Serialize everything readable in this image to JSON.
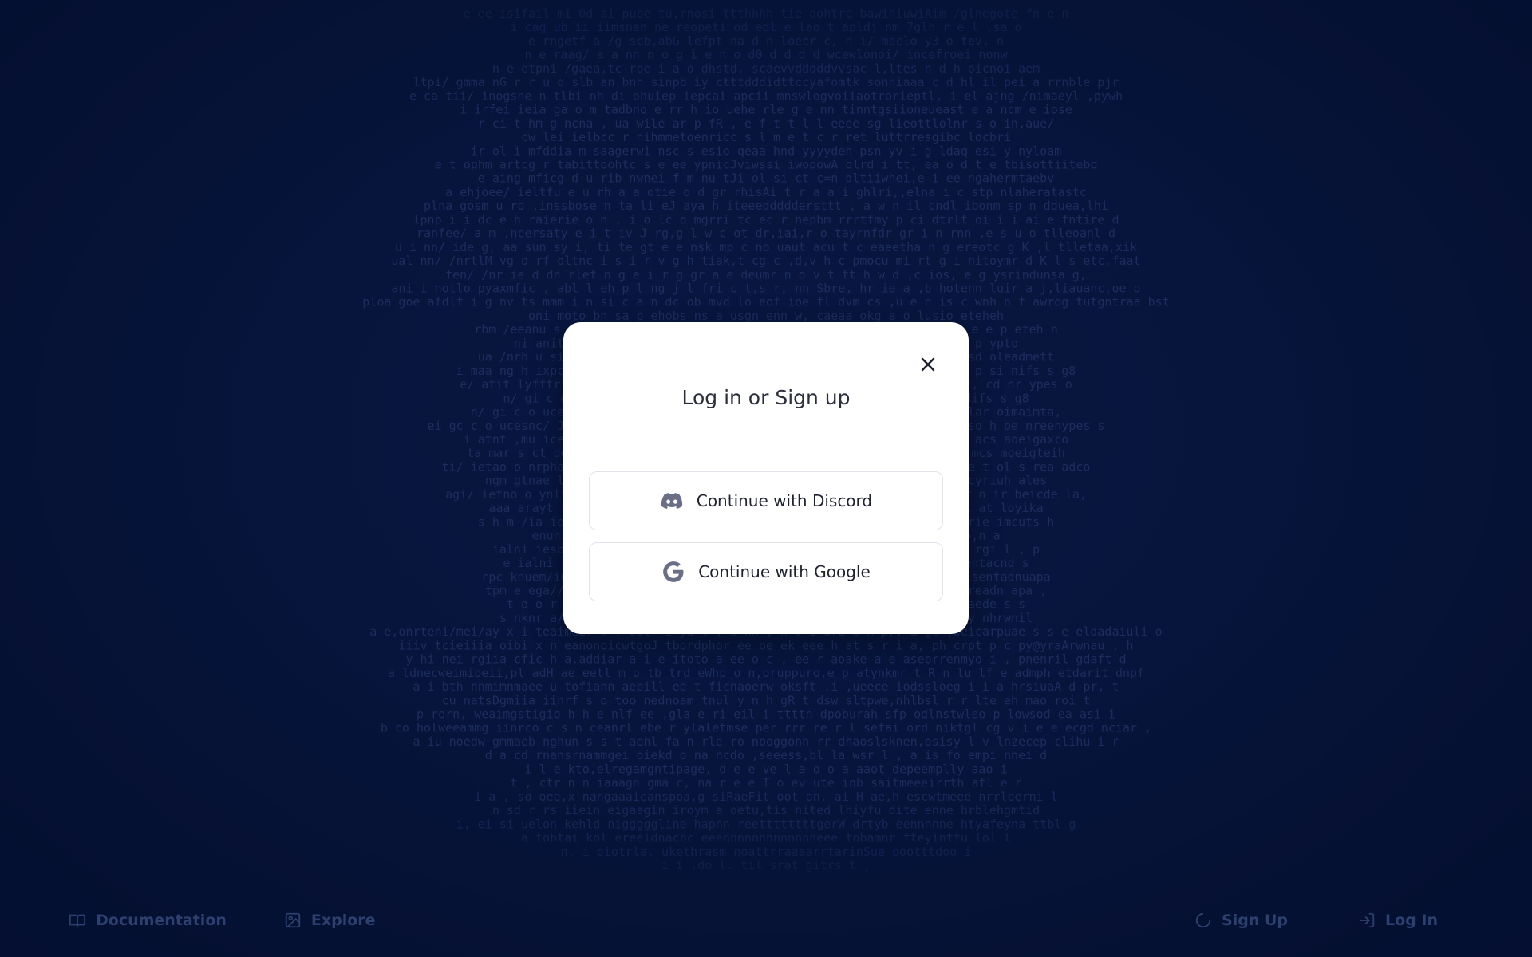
{
  "modal": {
    "title": "Log in or Sign up",
    "close_icon": "close-icon",
    "buttons": [
      {
        "label": "Continue with Discord",
        "icon": "discord-icon"
      },
      {
        "label": "Continue with Google",
        "icon": "google-icon"
      }
    ]
  },
  "bottom_nav": {
    "left": [
      {
        "label": "Documentation",
        "icon": "book-icon"
      },
      {
        "label": "Explore",
        "icon": "image-icon"
      }
    ],
    "right": [
      {
        "label": "Sign Up",
        "icon": "spinner-icon"
      },
      {
        "label": "Log In",
        "icon": "login-icon"
      }
    ]
  },
  "background": {
    "lines": [
      "e    ee isifail      mi 0d ai pube   tu,rnosi   ttthhhh     tie oohtre bawiniuwiAim        /glnegote fn   e     n",
      "i    cag ub ii    iimsnan ne   reopeti      od          edl        e   lao t   apldj  nm        7glh  r e l   ,sa   o",
      "e   rngetf a     /g scb,abG lefpt                       na      d   n       loecr c, n   i/        meclo y3 o tev,   n",
      "n    e   raag/     a  a nn  n o    g   i    e     n     o     d0      d    d     d  d   wcewlonoi/   incefroei nonw",
      "n   e  etpni    /gaea,tc  roe    i    a     o     dhstd,     scaevvdddddvvsac    l,ltes n       d h   oicnoi aem",
      "ltpi/    gmma nG r    r    u o    slb  an bnh sinpb iy ctttdddidttccyafomtk sonniaaa c    d    hl il pei  a rrnble pjr",
      "e   ca  tii/    inogsne   n   tlbi nh  di ohuiep iepcai   apcii mnswlogvoiiaotrorieptl,  i      el ajng     /nimaeyl ,pywh",
      "i irfei   ieia ga o        m    tadbno e  rr  h  io   uehe        rle g e    nn tinntgsiioneueast e     a   ncm  e iose",
      "r   ci t hm    g ncna   ,   ua wile ar p fR   ,      e   f t           t   l      l   eeee  sg lieottlolnr s o        in,aue/",
      "cw  lei    ielbcc    r   nihmmetoenricc    s   l    m e             t    c  r  ret      luttrresgibc         locbri",
      "ir ol i   mfddia    m    saagerwi nsc  s   esio  qeaa hnd yyyydeh  psn    yv          i     g ldaq  esi      y   nyloam",
      "e   t  ophm   artcg    r    tabittoohtc     s    e ee ypnicJviwssi   iwooowA  olrd  i  tt, ea o d      t   e  tbisottiitebo",
      "e aing   mficg     d u     rib nwnei     f  m    nu  tJi ol       si     ct        c=n  dltiiwhei,e          i  ee ngahermtaebv",
      "a   ehjoee/  ieltfu    e u rh    a a otie o    d gr rhisAi     t   r         a  a   i     ghlri,,elna     i  c  stp nlaheratastc",
      "plna    gosm      u ro     ,inssbose      n  ta li     eJ     aya h  iteeedddddersttt  , a  w   n    il    cndl ibonm     sp  n dduea,lhi",
      "lpnp i i dc e      h     raierie o  n    ,    i o  lc     o  mgrri   tc ec       r nephm   rrrtfmy    p ci      dtrlt oi   i i  ai e  fntire d",
      "ranfee/   a  m         ,ncersaty   e      i t iv     J   rg,g l w     c  ot dr,iai,r   o     tayrnfdr gr    i   n rnn  ,e  s   u   o  tlleoanl d",
      "u i nn/   ide        g,     aa sun sy   i,    ti     te   gt e     e   nsk   mp    c     no    uaut acu t    c     eaeetha  n    g ereotc    g  K ,l tlletaa,xik",
      "ual nn/  /nrtlM   vg  o     rf oltnc    i   s i     r    v g h      tiak,t      cg    c ,d,v        h    c pmocu      mi rt g    i nitoymr d    K  l  s  etc,faat",
      "fen/  /nr ie   d     dn  rlef  n    g   e  i    r g  gr  a   e     deumr   n        o      v    t   tt       h w  d    ,c   ios, e     g   ysrindunsa g,",
      "ani i  notlo          pyaxmfic         ,  abl  l    eh p l   ng j    l fri    c t,s r,  nn  Sbre,  hr      ie   a      ,b    hotenn    luir a      j,liauanc,oe o",
      "ploa  goe           afdlf i    g   nv ts     mmm i   n si   c  a n dc ob  mvd lo eof  ioe fl dvm  cs ,u    e n         is  c wnh  n    f  awrog       tutgntraa bst",
      "oni   moto           bn sa    p     ehobs   ns     a  usgn                                        enn      w,      caeaa          okg a  o    lusio   eteheh",
      "rbm  /eeanu      s     ancxmo l a n   twv    gsendo  n nb  t sr                                    i  a  t    a   w,  t  ody        f  ic  e      e  p eteh n",
      "ni   anit           ,   rp a i      e twd      w fpa   rbj                                         r  mr   ens   l  p eny         shaeaup     ,,std  p ypto",
      "ua  /nrh u      si     ,e eid      tl  reat      fA     tb   pa ic,                               oan    i   o,  o  e wan        shae,s    i osd oleadmett",
      "i maa      ng    h    ixpcol l a    ivp         t pg     t   i ,i pae                            ;d    sa m  tsam  t e ona      e haar n  p    si nifs  s g8",
      "e/  atit          lyfftrf    tg  h ti  l   dw2tr  ts,   fi ao se                                  o      ia  b  i   i,  t u lna      n   ei t,      cd  nr   ypes    o",
      "n/  gi c           eiusi p        pd      h fs  gts   iH5  n  n                                   a  i  b  ie    g  n    u  f     l  shi   n   enidifs  s g8",
      "n/  gi c       o    uceunc/       sb s     y t v kdar    o o a                                    t  i  l  s    sae o  k lnn     o ikmmga      lar oimaimta,",
      "ei gc c       o     ucesnc/ J     no n     cndem  , y     trl mL                                  iGsdb i t c    ntok tsc oaa  a  ssJ s so   h   oe  nreenypes   s",
      "i  atnt            ,mu ice     a    las      t t l ars  i   mwe lo                               hc pi    i   d   rn H   ixthn      icoke  c  s     acs aoeigaxco",
      "ta  mar s      ct    do fld         wrda         r n  f c era i                                   eh   doac   i    mds tsa oaa     /tokagn    s    mcs moeigteih",
      "ti/ ietao    o      nrphar          retie e   e o,     l a   , tl vn                              To  0o oou tstio        loa   h te ewnie   t   ol s rea adco",
      "ngm  gtnae          ls i p         saei        ls  g t   eea ite o                                v kne  i h dn k     oul        oc ug o        ,cyriuh  ales",
      "agi/ ietno    o     ynlfowl a        loau        ii   as    or tw a                               ho    ne  c, o  eb e gr los  n  /iirpr n         ir beicde la,",
      "aaa  arayt       t    ien y l        ii  s       S    un r  ,o n                                  od  ir  i  o  ee         oan     l dsr ug'c        ol  at loyika",
      "s h m /ia io          doc  t.        iloyn        t  r l eeo     h                                btnut nu   nar  e     o          t tewish  t    o rie imcuts h",
      "enuni inci           loc  tea          i i    e vst   o   b                                        nh c     ,e u       in          eha       s    citiahlno,n a",
      "ialni iesb           o aude e a      b eii       G   oe  r ,                                       he     us        nief p    i i iea   ,r      cl  ye rgi l ,   p",
      "e ialni ieci,       ao    ianilgra      a    oanao    ,  tie                                       ,  l  n           a  i   dmucaoins          oi tentacnd s",
      "rpc knuem/ina/le         ad a    ,  y o  ysceec     i i  u  -                                     onnek e r   ra        olih iae  c      isentadnuapa",
      "tpm e ega//gea,l   p       iyirfcs a  n  g  ofrnt        att                                      arn k        ork        / acaa olh        hmsreadn apa ,",
      "t o o r nii/m tb           u ni  sha a       leos       e   stS                                   r  m on        f ostpau'l        a ,seinaede s  s",
      "s nknr a/iieari          o nrfiy ,        to osai   l                                          c g t m yd   V  g i arte gmh     ,       zy nhrwnil",
      "a e,onrteni/mei/ay   x       i teaimeEr a ,      ootr i       ya t  ,   a  nn , n  o e ara o   n pr, a  ge   ,weicarpuae       s  s e eldadaiuli o",
      "iiiv tcieiiia oibi    x     n eanonoicwtgoJ      tbordphor   ee oe        ek    eee   h at     s       r   i  a,        ph crpt  p c         py@yraArwnau  ,     h",
      "y hi nei rgiia cfic         h     a.addiar a   i  e   itoto  a ee           o         c      ,     ee  r aoake     a  e aseprrenmyo          i , pnenril gdaft      d",
      "a  ldnecweimioeii,pl              adH  ae eetl      m o     tb  trd eWhp o n,oruppuro,e   p atynkmr  t    R n    lu lf  e admph               etdarit dnpf",
      "a  i bth nnmimnmaee        u      tofiann  aepill       ee t       ficnaoerw       oksft  .i            ,ueece iodssloeg         i i a  hrsiuaA d pr,  t",
      "cu natsDgmiia iinrf          s o      too  nednoam tnul y  n          h         gR           t  dsw  sltpwe,nhlbsl             r r  lte eh mao roi  t",
      "p  rorn, weaimgstigio       h   h     e  nlf  ee ,gla e ri eil i        ttttn         dpoburah    sfp odlnstwleo          p  lowsod  ea  asi  i",
      "b             co holweeammg iinrco          c s      n  ceanrl ebe r ylaletmse  per rrr re  r l  sefai ord niktgl cg      v       i e   e ecgd  nciar ,",
      "a  iu noedw gmmaeb nghun           s  s      t  aenl fa  n rle ro nooggonn rr dhaoslsknen,osisy     l         v   lnzecep  clihu i     r",
      "d          a  cd rnansrnammgei oiekd          o                 na     ncdo ,seeess,bl la   wsr         l         ,  a is fo empi nnei   d",
      "i   l  e kto,elregamgntipage, d              e              e                ve  l a      o   o  a  aaot depeemplly aao    i",
      "t   , ctr n n iaaagn  gma c, na r  e          e                T       o   ev ute  inb saitmeeeirrth afl            e   r",
      "i       a       ,  so oee,x nangaaaieanspoa,g  siRaeFit      oot             on,    ai H   ae,h escwtmeee nrrleerni       l",
      "n          sd   r rs iiein eigaagin  iroym a  oetu,tis            nited lhiyfu  dite enne hrblehgmtid",
      "i,              ei  si uelon kehld  nigggggline hapnn reettttttttgerW drtyb eennnnne htyafeyna ttbl      g",
      "a             tobtai  kol    ereeidnacbc eeennnnnnnnnnnnneee tobamnr fteyintfu lol      l",
      "n,            i    oiotrla,   ukethrasm noattrraaaarrtarinSue oootttdoo               i",
      "i        i        ,do lu til srat          gitrs           t          ,"
    ]
  }
}
